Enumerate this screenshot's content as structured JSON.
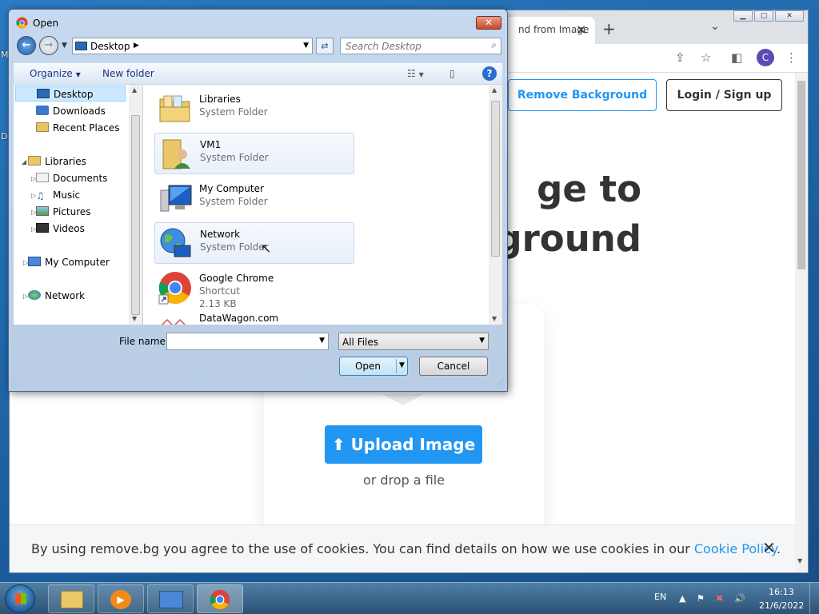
{
  "desktop": {
    "letters": [
      "M",
      "D"
    ]
  },
  "browser": {
    "tab": {
      "title": "nd from Image",
      "close": "✕"
    },
    "new_tab": "+",
    "avatar_letter": "C",
    "page": {
      "remove_background": "Remove Background",
      "login_signup": "Login / Sign up",
      "hero_line1": "ge to",
      "hero_line2": "ground",
      "upload_button": "Upload Image",
      "drop_text": "or drop a file",
      "cookie_text": "By using remove.bg you agree to the use of cookies. You can find details on how we use cookies in our ",
      "cookie_link": "Cookie Policy",
      "cookie_end": ".",
      "cookie_close": "✕"
    }
  },
  "dialog": {
    "title": "Open",
    "address": "Desktop",
    "search_placeholder": "Search Desktop",
    "organize": "Organize",
    "new_folder": "New folder",
    "help": "?",
    "nav": [
      {
        "label": "Desktop",
        "icon": "desktop-icon"
      },
      {
        "label": "Downloads",
        "icon": "downloads-icon"
      },
      {
        "label": "Recent Places",
        "icon": "recent-places-icon"
      },
      {
        "label": "Libraries",
        "icon": "libraries-icon"
      },
      {
        "label": "Documents",
        "icon": "documents-icon"
      },
      {
        "label": "Music",
        "icon": "music-icon"
      },
      {
        "label": "Pictures",
        "icon": "pictures-icon"
      },
      {
        "label": "Videos",
        "icon": "videos-icon"
      },
      {
        "label": "My Computer",
        "icon": "computer-icon"
      },
      {
        "label": "Network",
        "icon": "network-icon"
      }
    ],
    "files": [
      {
        "name": "Libraries",
        "type": "System Folder",
        "size": ""
      },
      {
        "name": "VM1",
        "type": "System Folder",
        "size": ""
      },
      {
        "name": "My Computer",
        "type": "System Folder",
        "size": ""
      },
      {
        "name": "Network",
        "type": "System Folder",
        "size": ""
      },
      {
        "name": "Google Chrome",
        "type": "Shortcut",
        "size": "2.13 KB"
      },
      {
        "name": "DataWagon.com",
        "type": "",
        "size": ""
      }
    ],
    "filename_label": "File name:",
    "filename_value": "",
    "filetype": "All Files",
    "open": "Open",
    "cancel": "Cancel"
  },
  "taskbar": {
    "language": "EN",
    "time": "16:13",
    "date": "21/6/2022"
  }
}
